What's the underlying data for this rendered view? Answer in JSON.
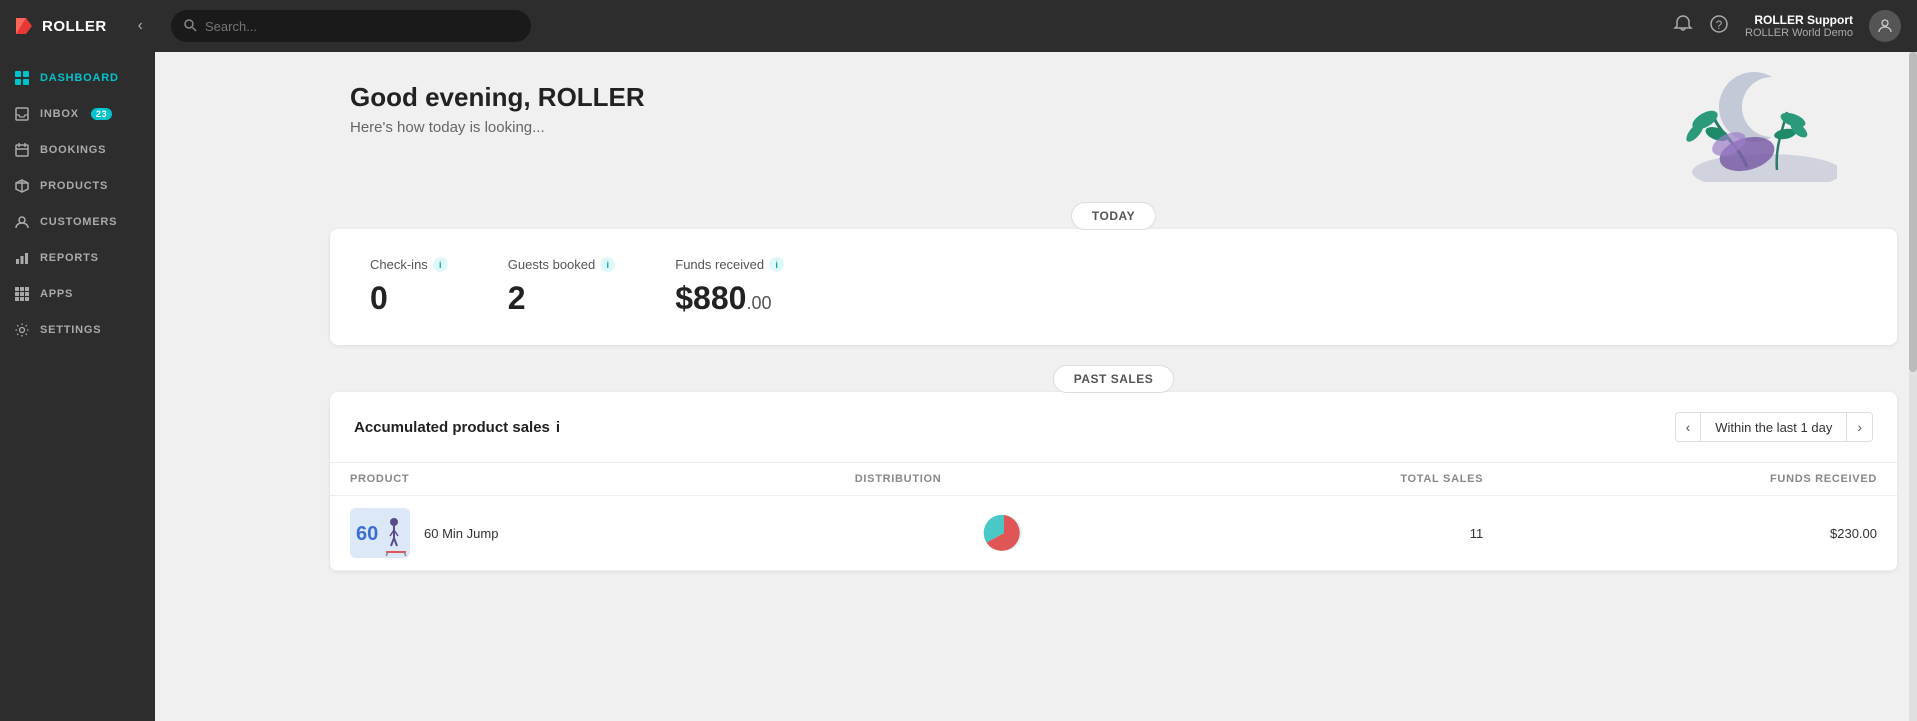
{
  "app": {
    "name": "ROLLER"
  },
  "topbar": {
    "search_placeholder": "Search...",
    "user_name": "ROLLER Support",
    "user_venue": "ROLLER World Demo"
  },
  "sidebar": {
    "items": [
      {
        "id": "dashboard",
        "label": "DASHBOARD",
        "icon": "grid",
        "active": true,
        "badge": null
      },
      {
        "id": "inbox",
        "label": "INBOX",
        "icon": "inbox",
        "active": false,
        "badge": "23"
      },
      {
        "id": "bookings",
        "label": "BOOKINGS",
        "icon": "calendar",
        "active": false,
        "badge": null
      },
      {
        "id": "products",
        "label": "PRODUCTS",
        "icon": "tag",
        "active": false,
        "badge": null
      },
      {
        "id": "customers",
        "label": "CUSTOMERS",
        "icon": "user",
        "active": false,
        "badge": null
      },
      {
        "id": "reports",
        "label": "REPORTS",
        "icon": "bar-chart",
        "active": false,
        "badge": null
      },
      {
        "id": "apps",
        "label": "APPS",
        "icon": "grid-small",
        "active": false,
        "badge": null
      },
      {
        "id": "settings",
        "label": "SETTINGS",
        "icon": "gear",
        "active": false,
        "badge": null
      }
    ]
  },
  "hero": {
    "greeting": "Good evening, ROLLER",
    "subtitle": "Here's how today is looking..."
  },
  "today_label": "TODAY",
  "stats": {
    "checkins": {
      "label": "Check-ins",
      "value": "0"
    },
    "guests_booked": {
      "label": "Guests booked",
      "value": "2"
    },
    "funds_received": {
      "label": "Funds received",
      "value": "$880",
      "cents": ".00"
    }
  },
  "past_sales_label": "PAST SALES",
  "product_sales": {
    "title": "Accumulated product sales",
    "date_range": "Within the last 1 day",
    "columns": [
      "PRODUCT",
      "DISTRIBUTION",
      "TOTAL SALES",
      "FUNDS RECEIVED"
    ],
    "rows": [
      {
        "name": "60 Min Jump",
        "total_sales": "11",
        "funds_received": "$230.00"
      }
    ]
  }
}
